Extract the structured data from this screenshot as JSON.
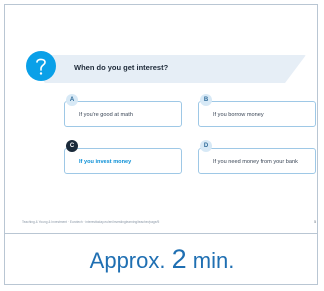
{
  "question": {
    "icon": "question-mark-icon",
    "text": "When do you get interest?"
  },
  "options": [
    {
      "letter": "A",
      "label": "If you're good at math",
      "selected": false
    },
    {
      "letter": "B",
      "label": "If you borrow money",
      "selected": false
    },
    {
      "letter": "C",
      "label": "If you invest money",
      "selected": true
    },
    {
      "letter": "D",
      "label": "If you need money from your bank",
      "selected": false
    }
  ],
  "footer": {
    "text": "Teaching & Young & Investment · Eurotech · interesttoday.eu/en/investinglearning/teacher/page/5",
    "page_number": "5"
  },
  "duration": {
    "prefix": "Approx.",
    "value": "2",
    "unit": "min."
  },
  "colors": {
    "accent": "#0aa0e8",
    "selected_text": "#0a8fd6",
    "option_border": "#9ec8e6",
    "duration_text": "#1f6fb2"
  }
}
